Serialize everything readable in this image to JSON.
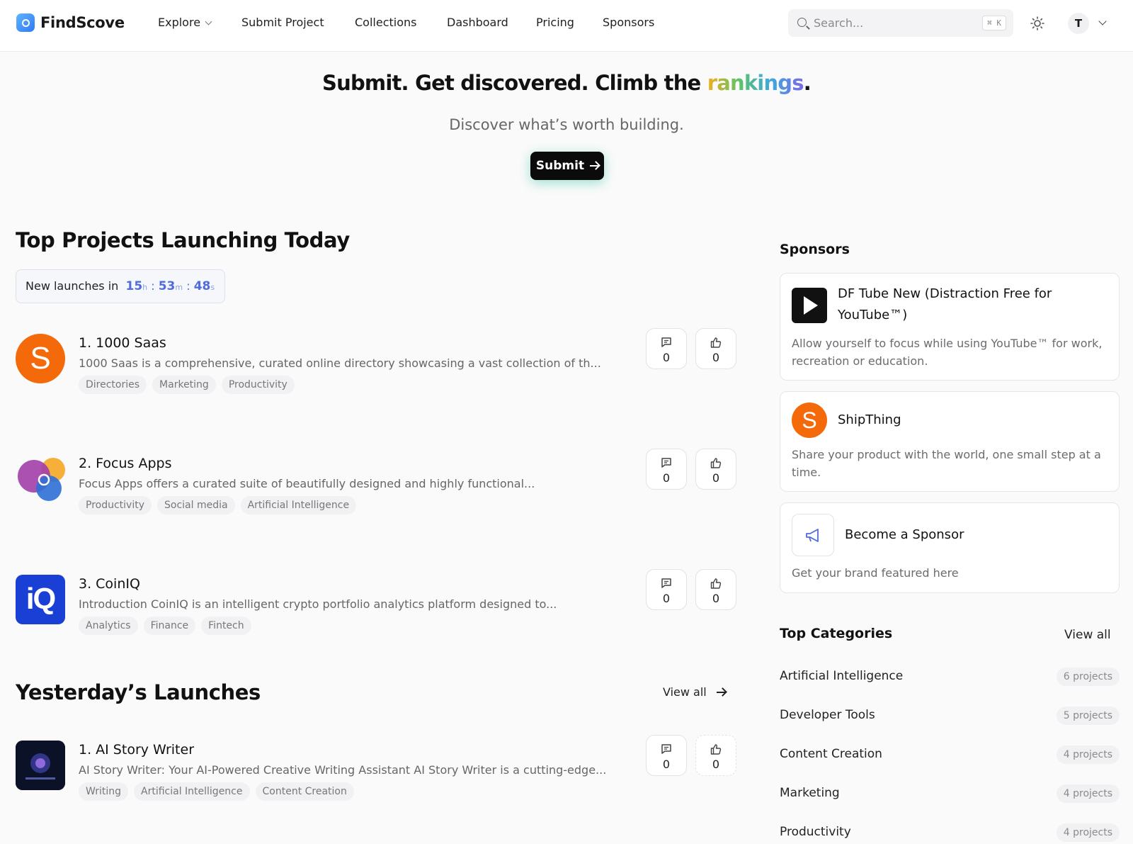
{
  "brand": {
    "name": "FindScove",
    "accent": "#2f7bf5"
  },
  "nav": {
    "explore": "Explore",
    "submit_project": "Submit Project",
    "collections": "Collections",
    "dashboard": "Dashboard",
    "pricing": "Pricing",
    "sponsors": "Sponsors"
  },
  "search": {
    "placeholder": "Search...",
    "shortcut": "⌘ K"
  },
  "user": {
    "initial": "T"
  },
  "hero": {
    "title_prefix": "Submit. Get discovered. Climb the ",
    "title_highlight": "rankings",
    "title_suffix": ".",
    "subtitle": "Discover what’s worth building.",
    "submit_label": "Submit"
  },
  "today": {
    "title": "Top Projects Launching Today",
    "timer_label": "New launches in",
    "hours": "15",
    "hours_unit": "h",
    "minutes": "53",
    "minutes_unit": "m",
    "seconds": "48",
    "seconds_unit": "s",
    "projects": [
      {
        "name": "1. 1000 Saas",
        "description": "1000 Saas is a comprehensive, curated online directory showcasing a vast collection of th...",
        "tags": [
          "Directories",
          "Marketing",
          "Productivity"
        ],
        "comments": "0",
        "upvotes": "0",
        "logo": "S"
      },
      {
        "name": "2. Focus Apps",
        "description": "Focus Apps offers a curated suite of beautifully designed and highly functional...",
        "tags": [
          "Productivity",
          "Social media",
          "Artificial Intelligence"
        ],
        "comments": "0",
        "upvotes": "0"
      },
      {
        "name": "3. CoinIQ",
        "description": "Introduction CoinIQ is an intelligent crypto portfolio analytics platform designed to...",
        "tags": [
          "Analytics",
          "Finance",
          "Fintech"
        ],
        "comments": "0",
        "upvotes": "0",
        "logo": "iQ"
      }
    ]
  },
  "yesterday": {
    "title": "Yesterday’s Launches",
    "view_all": "View all",
    "projects": [
      {
        "name": "1. AI Story Writer",
        "description": "AI Story Writer: Your AI-Powered Creative Writing Assistant AI Story Writer is a cutting-edge...",
        "tags": [
          "Writing",
          "Artificial Intelligence",
          "Content Creation"
        ],
        "comments": "0",
        "upvotes": "0"
      }
    ]
  },
  "sponsors": {
    "title": "Sponsors",
    "items": [
      {
        "name": "DF Tube New (Distraction Free for YouTube™)",
        "description": "Allow yourself to focus while using YouTube™ for work, recreation or education."
      },
      {
        "name": "ShipThing",
        "description": "Share your product with the world, one small step at a time.",
        "logo": "S"
      }
    ],
    "become": {
      "name": "Become a Sponsor",
      "description": "Get your brand featured here"
    }
  },
  "categories": {
    "title": "Top Categories",
    "view_all": "View all",
    "items": [
      {
        "name": "Artificial Intelligence",
        "count": "6 projects"
      },
      {
        "name": "Developer Tools",
        "count": "5 projects"
      },
      {
        "name": "Content Creation",
        "count": "4 projects"
      },
      {
        "name": "Marketing",
        "count": "4 projects"
      },
      {
        "name": "Productivity",
        "count": "4 projects"
      }
    ]
  }
}
